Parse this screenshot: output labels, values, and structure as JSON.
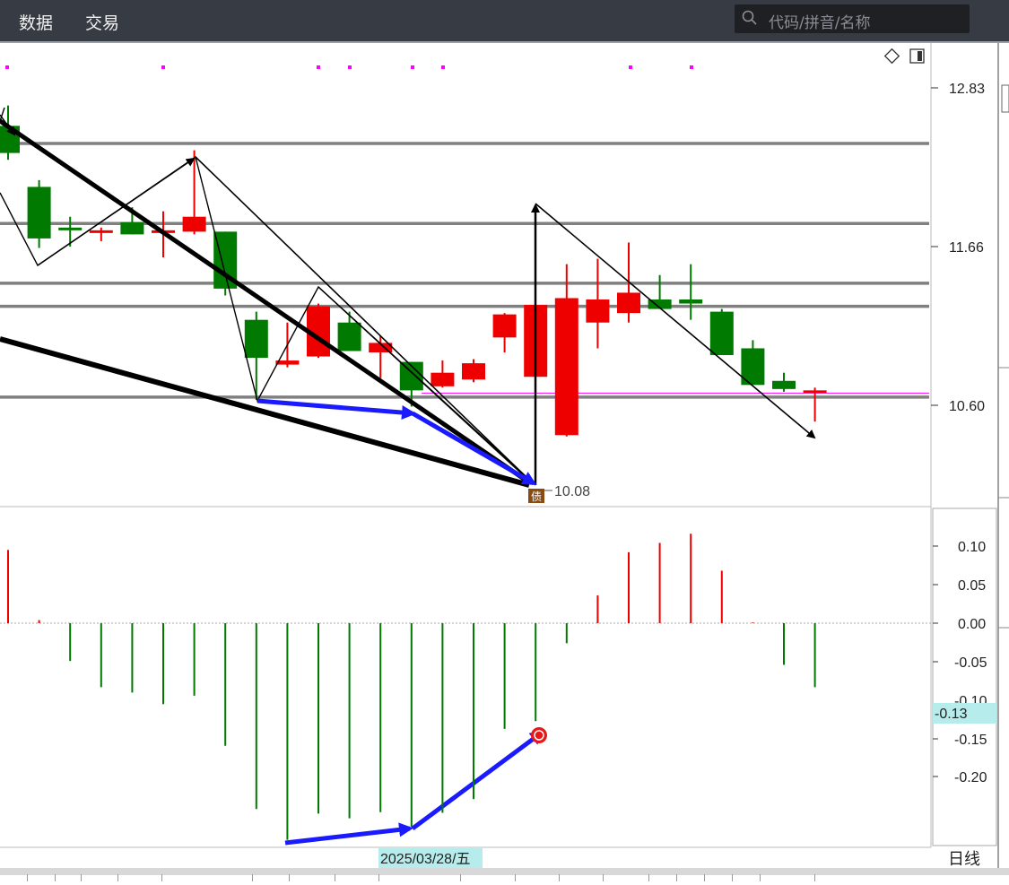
{
  "menu": {
    "data_label": "数据",
    "trade_label": "交易"
  },
  "search": {
    "placeholder": "代码/拼音/名称"
  },
  "price_axis": {
    "ticks": [
      "12.83",
      "11.66",
      "10.60"
    ]
  },
  "low_marker": {
    "label": "10.08",
    "badge": "债"
  },
  "macd_axis": {
    "ticks": [
      "0.10",
      "0.05",
      "0.00",
      "-0.05",
      "-0.10",
      "-0.15",
      "-0.20"
    ],
    "current": "-0.13"
  },
  "date_cursor": "2025/03/28/五",
  "period_button": "日线",
  "colors": {
    "up": "#ee0000",
    "down": "#007a00",
    "arrow_blue": "#1a1aff",
    "magenta": "#ff00ff",
    "bg_top": "#373b43"
  },
  "chart_data": [
    {
      "type": "candlestick",
      "ylim": [
        10.0,
        12.95
      ],
      "candles": [
        {
          "o": 12.55,
          "h": 12.7,
          "l": 12.3,
          "c": 12.35
        },
        {
          "o": 12.1,
          "h": 12.15,
          "l": 11.65,
          "c": 11.72
        },
        {
          "o": 11.8,
          "h": 11.88,
          "l": 11.66,
          "c": 11.78
        },
        {
          "o": 11.78,
          "h": 11.8,
          "l": 11.7,
          "c": 11.78
        },
        {
          "o": 11.84,
          "h": 11.95,
          "l": 11.75,
          "c": 11.75
        },
        {
          "o": 11.78,
          "h": 11.92,
          "l": 11.58,
          "c": 11.78
        },
        {
          "o": 11.77,
          "h": 12.37,
          "l": 11.75,
          "c": 11.88
        },
        {
          "o": 11.77,
          "h": 11.77,
          "l": 11.3,
          "c": 11.35
        },
        {
          "o": 11.12,
          "h": 11.18,
          "l": 10.53,
          "c": 10.84
        },
        {
          "o": 10.79,
          "h": 11.1,
          "l": 10.77,
          "c": 10.82
        },
        {
          "o": 10.85,
          "h": 11.24,
          "l": 10.84,
          "c": 11.22
        },
        {
          "o": 11.1,
          "h": 11.18,
          "l": 10.9,
          "c": 10.89
        },
        {
          "o": 10.88,
          "h": 11.0,
          "l": 10.69,
          "c": 10.95
        },
        {
          "o": 10.81,
          "h": 10.81,
          "l": 10.48,
          "c": 10.6
        },
        {
          "o": 10.63,
          "h": 10.82,
          "l": 10.62,
          "c": 10.73
        },
        {
          "o": 10.68,
          "h": 10.83,
          "l": 10.66,
          "c": 10.8
        },
        {
          "o": 10.99,
          "h": 11.17,
          "l": 10.88,
          "c": 11.16
        },
        {
          "o": 10.7,
          "h": 11.23,
          "l": 10.7,
          "c": 11.23
        },
        {
          "o": 10.27,
          "h": 11.53,
          "l": 10.26,
          "c": 11.28
        },
        {
          "o": 11.1,
          "h": 11.57,
          "l": 10.91,
          "c": 11.27
        },
        {
          "o": 11.17,
          "h": 11.69,
          "l": 11.1,
          "c": 11.32
        },
        {
          "o": 11.27,
          "h": 11.45,
          "l": 11.2,
          "c": 11.2
        },
        {
          "o": 11.27,
          "h": 11.53,
          "l": 11.12,
          "c": 11.24
        },
        {
          "o": 11.18,
          "h": 11.2,
          "l": 10.87,
          "c": 10.86
        },
        {
          "o": 10.91,
          "h": 10.97,
          "l": 10.65,
          "c": 10.64
        },
        {
          "o": 10.67,
          "h": 10.73,
          "l": 10.59,
          "c": 10.61
        },
        {
          "o": 10.58,
          "h": 10.62,
          "l": 10.37,
          "c": 10.6
        }
      ],
      "horizontal_levels": [
        12.42,
        11.83,
        11.39,
        11.22,
        10.55
      ],
      "magenta_level": 10.58
    },
    {
      "type": "bar",
      "ylim": [
        -0.26,
        0.13
      ],
      "values": [
        0.095,
        0.004,
        -0.049,
        -0.083,
        -0.09,
        -0.105,
        -0.094,
        -0.159,
        -0.241,
        -0.281,
        -0.247,
        -0.253,
        -0.245,
        -0.264,
        -0.246,
        -0.228,
        -0.137,
        -0.127,
        -0.026,
        0.036,
        0.092,
        0.104,
        0.116,
        0.068,
        0.001,
        -0.054,
        -0.083
      ]
    }
  ]
}
